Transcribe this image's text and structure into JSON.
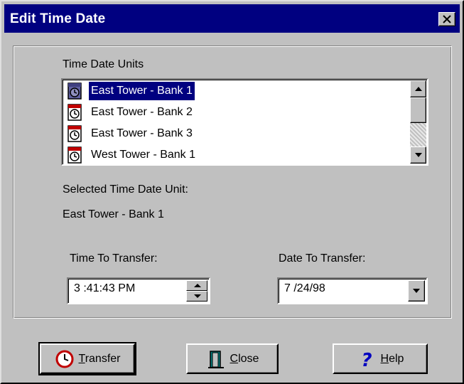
{
  "window": {
    "title": "Edit Time Date"
  },
  "units": {
    "label": "Time Date Units",
    "items": [
      {
        "label": "East Tower - Bank 1",
        "selected": true
      },
      {
        "label": "East Tower - Bank 2",
        "selected": false
      },
      {
        "label": "East Tower - Bank 3",
        "selected": false
      },
      {
        "label": "West Tower - Bank 1",
        "selected": false
      }
    ]
  },
  "selected_unit": {
    "label": "Selected Time Date Unit:",
    "value": "East Tower - Bank 1"
  },
  "time": {
    "label": "Time To Transfer:",
    "value": "3 :41:43 PM"
  },
  "date": {
    "label": "Date  To Transfer:",
    "value": "7 /24/98"
  },
  "buttons": {
    "transfer": {
      "mnemonic": "T",
      "rest": "ransfer"
    },
    "close": {
      "mnemonic": "C",
      "rest": "lose"
    },
    "help": {
      "mnemonic": "H",
      "rest": "elp"
    }
  },
  "colors": {
    "face": "#c0c0c0",
    "title_bar": "#000080",
    "selection": "#000080"
  },
  "icons": {
    "list_item": "clock-document-icon",
    "transfer": "clock-icon",
    "close": "door-icon",
    "help": "question-mark-icon"
  }
}
